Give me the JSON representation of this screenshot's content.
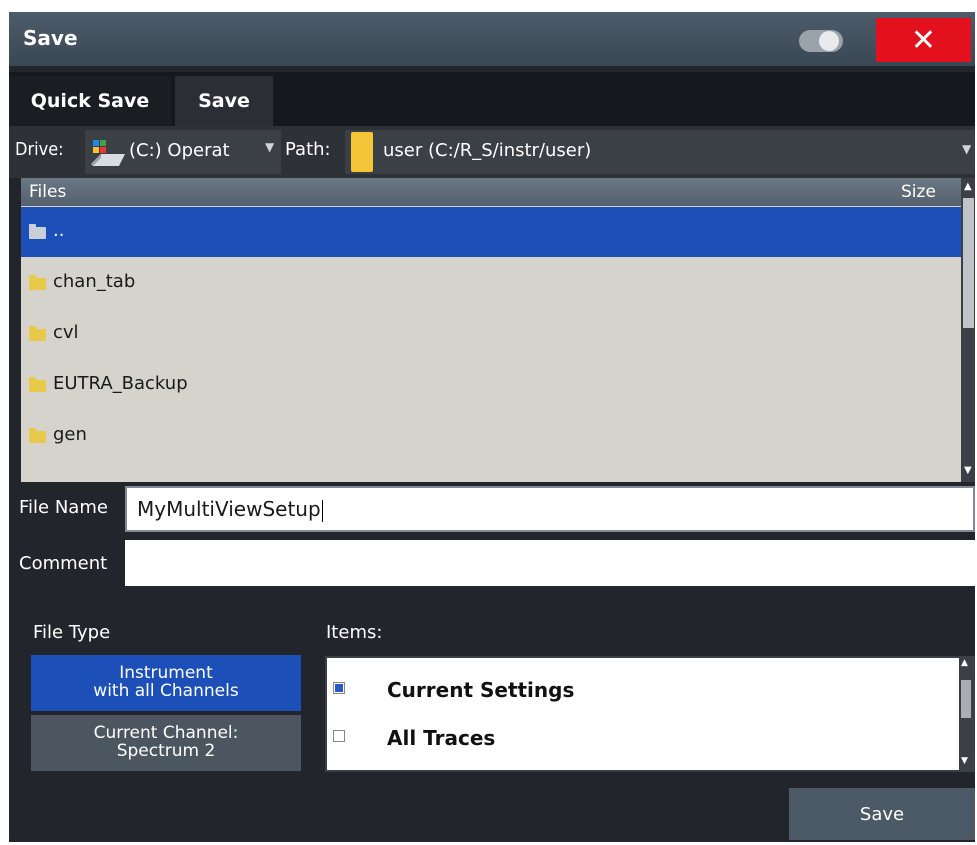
{
  "window": {
    "title": "Save",
    "close_symbol": "✕"
  },
  "tabs": [
    {
      "label": "Quick Save",
      "active": false
    },
    {
      "label": "Save",
      "active": true
    }
  ],
  "drive": {
    "label": "Drive:",
    "value": "(C:) Operat"
  },
  "path": {
    "label": "Path:",
    "value": "user (C:/R_S/instr/user)"
  },
  "file_list": {
    "columns": [
      "Files",
      "Size"
    ],
    "rows": [
      {
        "name": "..",
        "selected": true
      },
      {
        "name": "chan_tab",
        "selected": false
      },
      {
        "name": "cvl",
        "selected": false
      },
      {
        "name": "EUTRA_Backup",
        "selected": false
      },
      {
        "name": "gen",
        "selected": false
      }
    ]
  },
  "file_name": {
    "label": "File Name",
    "value": "MyMultiViewSetup"
  },
  "comment": {
    "label": "Comment",
    "value": ""
  },
  "file_type": {
    "label": "File Type",
    "options": [
      {
        "label": "Instrument\nwith all Channels",
        "active": true
      },
      {
        "label": "Current Channel:\nSpectrum 2",
        "active": false
      }
    ]
  },
  "items": {
    "label": "Items:",
    "list": [
      {
        "label": "Current Settings",
        "checked": true
      },
      {
        "label": "All Traces",
        "checked": false
      }
    ]
  },
  "save_button": {
    "label": "Save"
  },
  "colors": {
    "accent": "#1d4fb8",
    "close": "#e3101e",
    "background": "#22262c"
  }
}
